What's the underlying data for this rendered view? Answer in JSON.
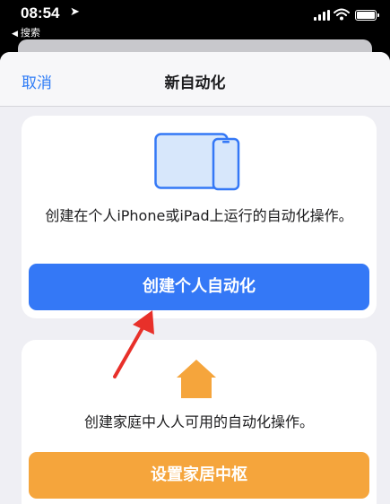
{
  "status_bar": {
    "time": "08:54",
    "location_arrow": "➤",
    "back_app": "搜索"
  },
  "nav": {
    "cancel_label": "取消",
    "title": "新自动化"
  },
  "personal": {
    "description": "创建在个人iPhone或iPad上运行的自动化操作。",
    "button_label": "创建个人自动化",
    "icon": "iphone-ipad-icon"
  },
  "home": {
    "description": "创建家庭中人人可用的自动化操作。",
    "button_label": "设置家居中枢",
    "icon": "home-icon"
  },
  "colors": {
    "accent_blue": "#3478f6",
    "home_orange": "#f5a53c",
    "annotation_red": "#e8302a"
  }
}
